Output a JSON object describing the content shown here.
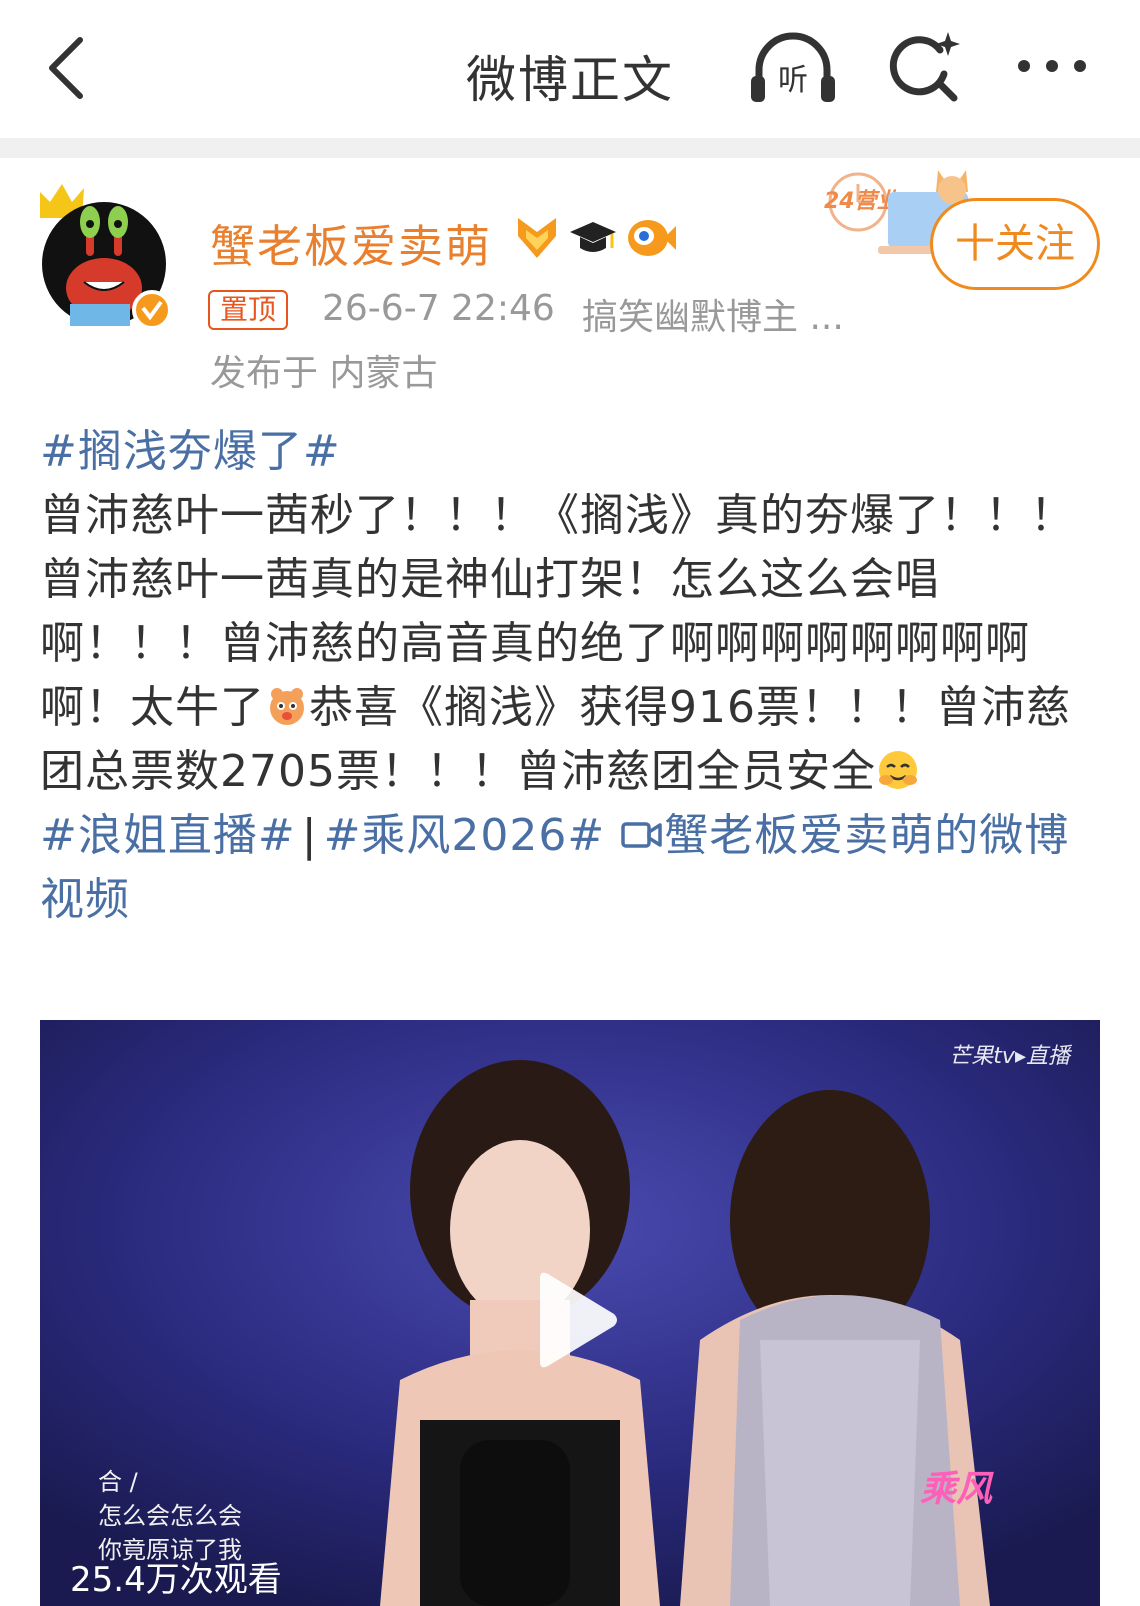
{
  "header": {
    "title": "微博正文",
    "listen_label": "听"
  },
  "author": {
    "name": "蟹老板爱卖萌",
    "pinned_label": "置顶",
    "timestamp": "26-6-7 22:46",
    "tag": "搞笑幽默博主 ...",
    "location": "发布于 内蒙古",
    "follow_label": "十关注",
    "promo_label": "24营业"
  },
  "post": {
    "topic1": "#搁浅夯爆了#",
    "text1": "曾沛慈叶一茜秒了！！！《搁浅》真的夯爆了！！！曾沛慈叶一茜真的是神仙打架！怎么这么会唱啊！！！曾沛慈的高音真的绝了啊啊啊啊啊啊啊啊啊！太牛了",
    "text2": "恭喜《搁浅》获得916票！！！曾沛慈团总票数2705票！！！曾沛慈团全员安全",
    "topic2": "#浪姐直播#",
    "separator": "|",
    "topic3": "#乘风2026#",
    "video_link": "蟹老板爱卖萌的微博视频"
  },
  "video": {
    "channel": "芒果tv▸直播",
    "subtitle_line1": "合 /",
    "subtitle_line2": "怎么会怎么会",
    "subtitle_line3": "你竟原谅了我",
    "views": "25.4万次观看",
    "show_logo": "乘风"
  },
  "colors": {
    "username": "#e8802f",
    "topic": "#4a6fa5",
    "follow": "#f08a1e",
    "pin": "#e8561e"
  }
}
